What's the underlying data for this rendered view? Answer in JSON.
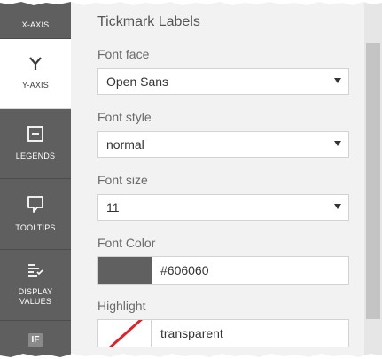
{
  "sidebar": {
    "items": [
      {
        "label": "X-AXIS",
        "icon": "x-axis-icon"
      },
      {
        "label": "Y-AXIS",
        "icon": "y-axis-icon",
        "active": true
      },
      {
        "label": "LEGENDS",
        "icon": "legend-icon"
      },
      {
        "label": "TOOLTIPS",
        "icon": "tooltip-icon"
      },
      {
        "label": "DISPLAY VALUES",
        "icon": "display-values-icon"
      },
      {
        "label": "IF",
        "icon": "if-icon"
      }
    ]
  },
  "section": {
    "title": "Tickmark Labels",
    "font_face": {
      "label": "Font face",
      "value": "Open Sans"
    },
    "font_style": {
      "label": "Font style",
      "value": "normal"
    },
    "font_size": {
      "label": "Font size",
      "value": "11"
    },
    "font_color": {
      "label": "Font Color",
      "value": "#606060",
      "swatch": "#606060"
    },
    "highlight": {
      "label": "Highlight",
      "value": "transparent"
    }
  },
  "colors": {
    "sidebar_bg": "#5f5f5f",
    "panel_bg": "#f2f2f2",
    "accent_red": "#e0202a"
  }
}
